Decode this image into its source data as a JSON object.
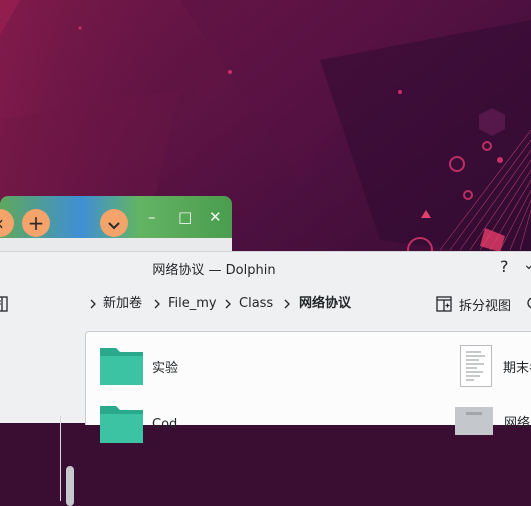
{
  "colors": {
    "folder": "#3cc3a4",
    "accent_orange": "#f4a36a",
    "window_bg": "#eff0f1",
    "view_bg": "#fcfcfc"
  },
  "background_window": {
    "new_tab_icon": "plus-icon",
    "dropdown_icon": "chevron-down-icon",
    "controls": [
      "minimize-icon",
      "maximize-icon",
      "close-icon"
    ]
  },
  "window": {
    "title": "网络协议 — Dolphin",
    "help_label": "?"
  },
  "breadcrumb": [
    "新加卷",
    "File_my",
    "Class",
    "网络协议"
  ],
  "toolbar": {
    "split_label": "拆分视图"
  },
  "files": [
    {
      "name": "实验",
      "type": "folder"
    },
    {
      "name": "期末考",
      "type": "document"
    },
    {
      "name": "Cod",
      "type": "folder"
    },
    {
      "name": "网络",
      "type": "document"
    }
  ]
}
